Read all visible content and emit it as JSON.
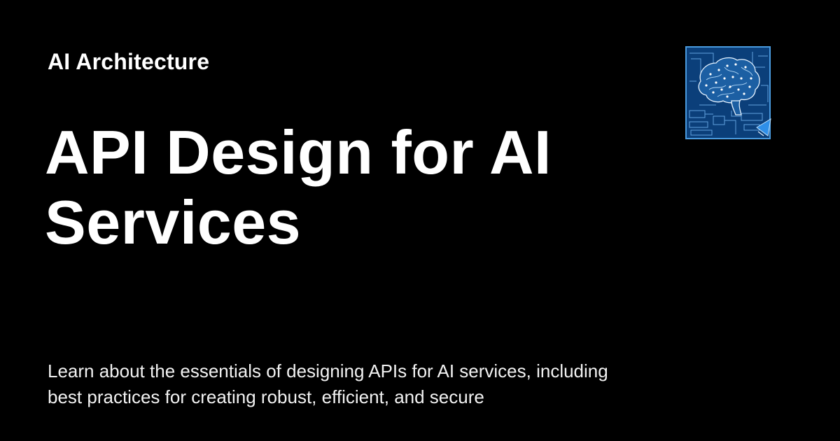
{
  "header": {
    "category": "AI Architecture"
  },
  "article": {
    "title": "API Design for AI Services",
    "description": "Learn about the essentials of designing APIs for AI services, including best practices for creating robust, efficient, and secure"
  },
  "logo": {
    "icon": "brain-circuit-blueprint-icon",
    "colors": {
      "background": "#0b3f7a",
      "border": "#4a9be0",
      "lines": "#7fc4ff",
      "accent": "#2f8fe8"
    }
  }
}
